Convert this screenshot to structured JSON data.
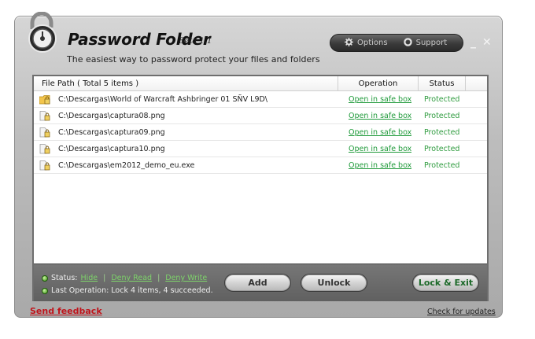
{
  "app": {
    "title": "Password Folder",
    "version": "Beta 1.1",
    "subtitle": "The easiest way to password protect your files and folders"
  },
  "topbar": {
    "options_label": "Options",
    "support_label": "Support",
    "minimize_symbol": "_",
    "close_symbol": "✕"
  },
  "table": {
    "headers": {
      "path": "File Path  ( Total 5 items )",
      "operation": "Operation",
      "status": "Status"
    },
    "rows": [
      {
        "icon": "folder-lock-icon",
        "path": "C:\\Descargas\\World of Warcraft  Ashbringer 01 SÑV L9D\\",
        "operation": "Open in safe box",
        "status": "Protected"
      },
      {
        "icon": "file-lock-icon",
        "path": "C:\\Descargas\\captura08.png",
        "operation": "Open in safe box",
        "status": "Protected"
      },
      {
        "icon": "file-lock-icon",
        "path": "C:\\Descargas\\captura09.png",
        "operation": "Open in safe box",
        "status": "Protected"
      },
      {
        "icon": "file-lock-icon",
        "path": "C:\\Descargas\\captura10.png",
        "operation": "Open in safe box",
        "status": "Protected"
      },
      {
        "icon": "file-lock-icon",
        "path": "C:\\Descargas\\em2012_demo_eu.exe",
        "operation": "Open in safe box",
        "status": "Protected"
      }
    ]
  },
  "status_bar": {
    "status_label": "Status:",
    "hide": "Hide",
    "deny_read": "Deny Read",
    "deny_write": "Deny Write",
    "separator": "|",
    "last_op": "Last Operation:  Lock 4 items, 4 succeeded."
  },
  "buttons": {
    "add": "Add",
    "unlock": "Unlock",
    "lock_exit": "Lock & Exit"
  },
  "footer": {
    "feedback": "Send feedback",
    "updates": "Check for updates"
  },
  "colors": {
    "link_green": "#1f9a3a",
    "feedback_red": "#c0151c"
  }
}
